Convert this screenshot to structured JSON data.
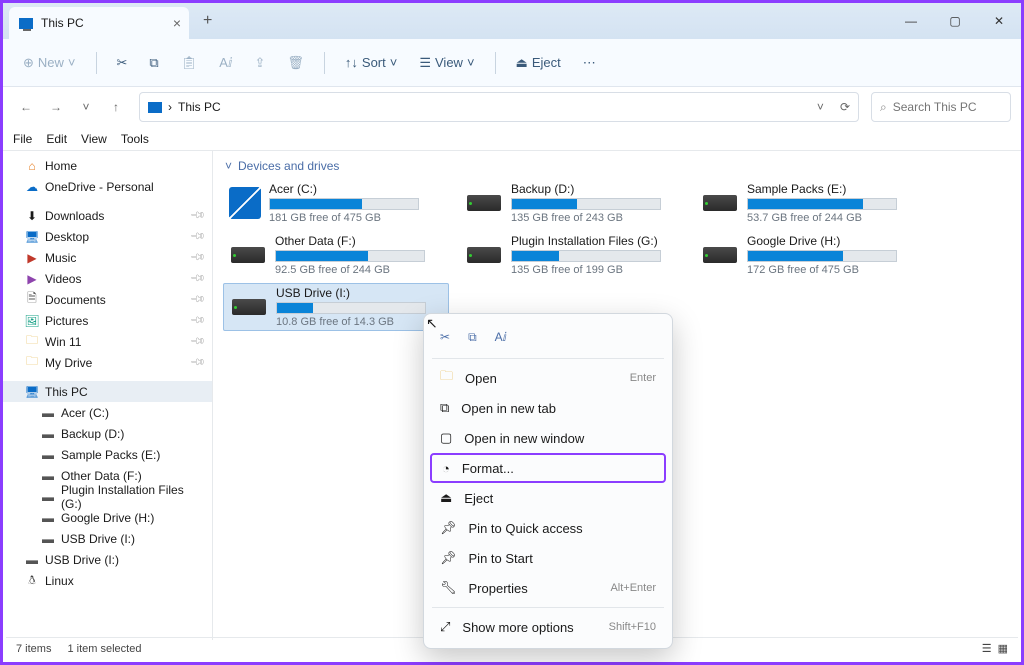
{
  "tab": {
    "title": "This PC"
  },
  "toolbar": {
    "new": "New",
    "sort": "Sort",
    "view": "View",
    "eject": "Eject"
  },
  "breadcrumb": "This PC",
  "search": {
    "placeholder": "Search This PC"
  },
  "menu": {
    "file": "File",
    "edit": "Edit",
    "view": "View",
    "tools": "Tools"
  },
  "sidebar": {
    "home": "Home",
    "onedrive": "OneDrive - Personal",
    "quick": [
      {
        "label": "Downloads"
      },
      {
        "label": "Desktop"
      },
      {
        "label": "Music"
      },
      {
        "label": "Videos"
      },
      {
        "label": "Documents"
      },
      {
        "label": "Pictures"
      },
      {
        "label": "Win 11"
      },
      {
        "label": "My Drive"
      }
    ],
    "thispc": "This PC",
    "drives": [
      {
        "label": "Acer (C:)"
      },
      {
        "label": "Backup (D:)"
      },
      {
        "label": "Sample Packs (E:)"
      },
      {
        "label": "Other Data (F:)"
      },
      {
        "label": "Plugin Installation Files (G:)"
      },
      {
        "label": "Google Drive (H:)"
      },
      {
        "label": "USB Drive (I:)"
      }
    ],
    "usb": "USB Drive (I:)",
    "linux": "Linux"
  },
  "group_header": "Devices and drives",
  "drives": [
    {
      "name": "Acer (C:)",
      "free": "181 GB free of 475 GB",
      "fill": 62,
      "icon": "win"
    },
    {
      "name": "Backup (D:)",
      "free": "135 GB free of 243 GB",
      "fill": 44,
      "icon": "hdd"
    },
    {
      "name": "Sample Packs (E:)",
      "free": "53.7 GB free of 244 GB",
      "fill": 78,
      "icon": "hdd"
    },
    {
      "name": "Other Data (F:)",
      "free": "92.5 GB free of 244 GB",
      "fill": 62,
      "icon": "hdd"
    },
    {
      "name": "Plugin Installation Files (G:)",
      "free": "135 GB free of 199 GB",
      "fill": 32,
      "icon": "hdd"
    },
    {
      "name": "Google Drive (H:)",
      "free": "172 GB free of 475 GB",
      "fill": 64,
      "icon": "hdd"
    },
    {
      "name": "USB Drive (I:)",
      "free": "10.8 GB free of 14.3 GB",
      "fill": 24,
      "icon": "hdd",
      "selected": true
    }
  ],
  "ctx": {
    "open": "Open",
    "open_sc": "Enter",
    "newtab": "Open in new tab",
    "newwin": "Open in new window",
    "format": "Format...",
    "eject": "Eject",
    "pinquick": "Pin to Quick access",
    "pinstart": "Pin to Start",
    "props": "Properties",
    "props_sc": "Alt+Enter",
    "more": "Show more options",
    "more_sc": "Shift+F10"
  },
  "status": {
    "count": "7 items",
    "sel": "1 item selected"
  }
}
